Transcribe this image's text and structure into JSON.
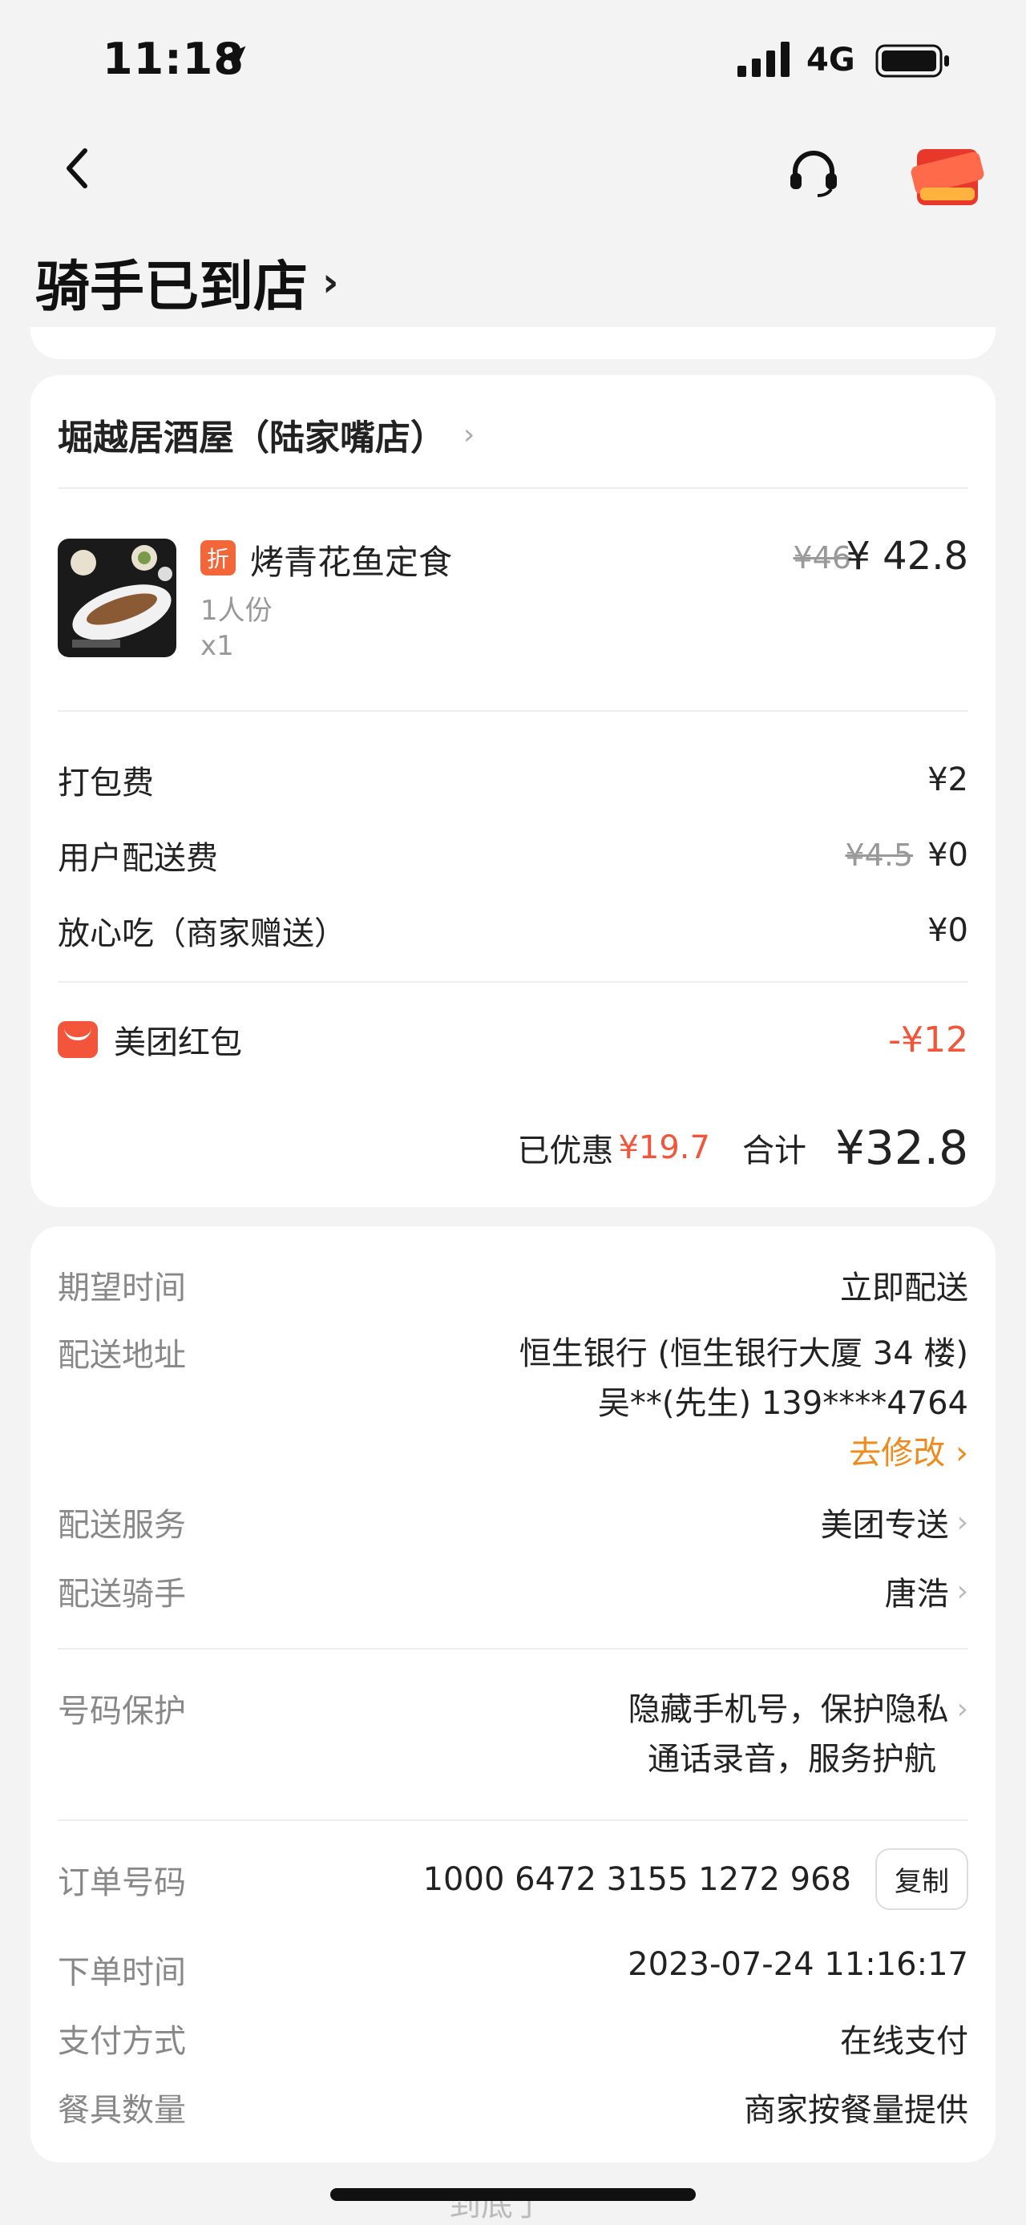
{
  "status_bar": {
    "time": "11:18",
    "network": "4G"
  },
  "header": {
    "title": "骑手已到店"
  },
  "order_card": {
    "shop_name": "堀越居酒屋（陆家嘴店）",
    "item": {
      "discount_tag": "折",
      "name": "烤青花鱼定食",
      "spec": "1人份",
      "qty": "x1",
      "original_price": "¥46",
      "price": "¥ 42.8"
    },
    "fees": [
      {
        "label": "打包费",
        "original": "",
        "value": "¥2"
      },
      {
        "label": "用户配送费",
        "original": "¥4.5",
        "value": "¥0"
      },
      {
        "label": "放心吃（商家赠送）",
        "original": "",
        "value": "¥0"
      }
    ],
    "red_packet": {
      "label": "美团红包",
      "value": "-¥12"
    },
    "summary": {
      "saved_label": "已优惠",
      "saved_value": "¥19.7",
      "total_label": "合计",
      "total_value": "¥32.8"
    }
  },
  "info_card": {
    "expected_time": {
      "label": "期望时间",
      "value": "立即配送"
    },
    "address": {
      "label": "配送地址",
      "line1": "恒生银行 (恒生银行大厦 34 楼)",
      "line2": "吴**(先生) 139****4764",
      "edit": "去修改"
    },
    "service": {
      "label": "配送服务",
      "value": "美团专送"
    },
    "rider": {
      "label": "配送骑手",
      "value": "唐浩"
    },
    "privacy": {
      "label": "号码保护",
      "line1": "隐藏手机号，保护隐私",
      "line2": "通话录音，服务护航"
    },
    "order_no": {
      "label": "订单号码",
      "value": "1000 6472 3155 1272 968",
      "copy": "复制"
    },
    "order_time": {
      "label": "下单时间",
      "value": "2023-07-24 11:16:17"
    },
    "payment": {
      "label": "支付方式",
      "value": "在线支付"
    },
    "utensils": {
      "label": "餐具数量",
      "value": "商家按餐量提供"
    }
  },
  "footer": {
    "partial_text": "到底了"
  },
  "colors": {
    "accent_red": "#f2553a",
    "link_orange": "#f08a1d"
  }
}
